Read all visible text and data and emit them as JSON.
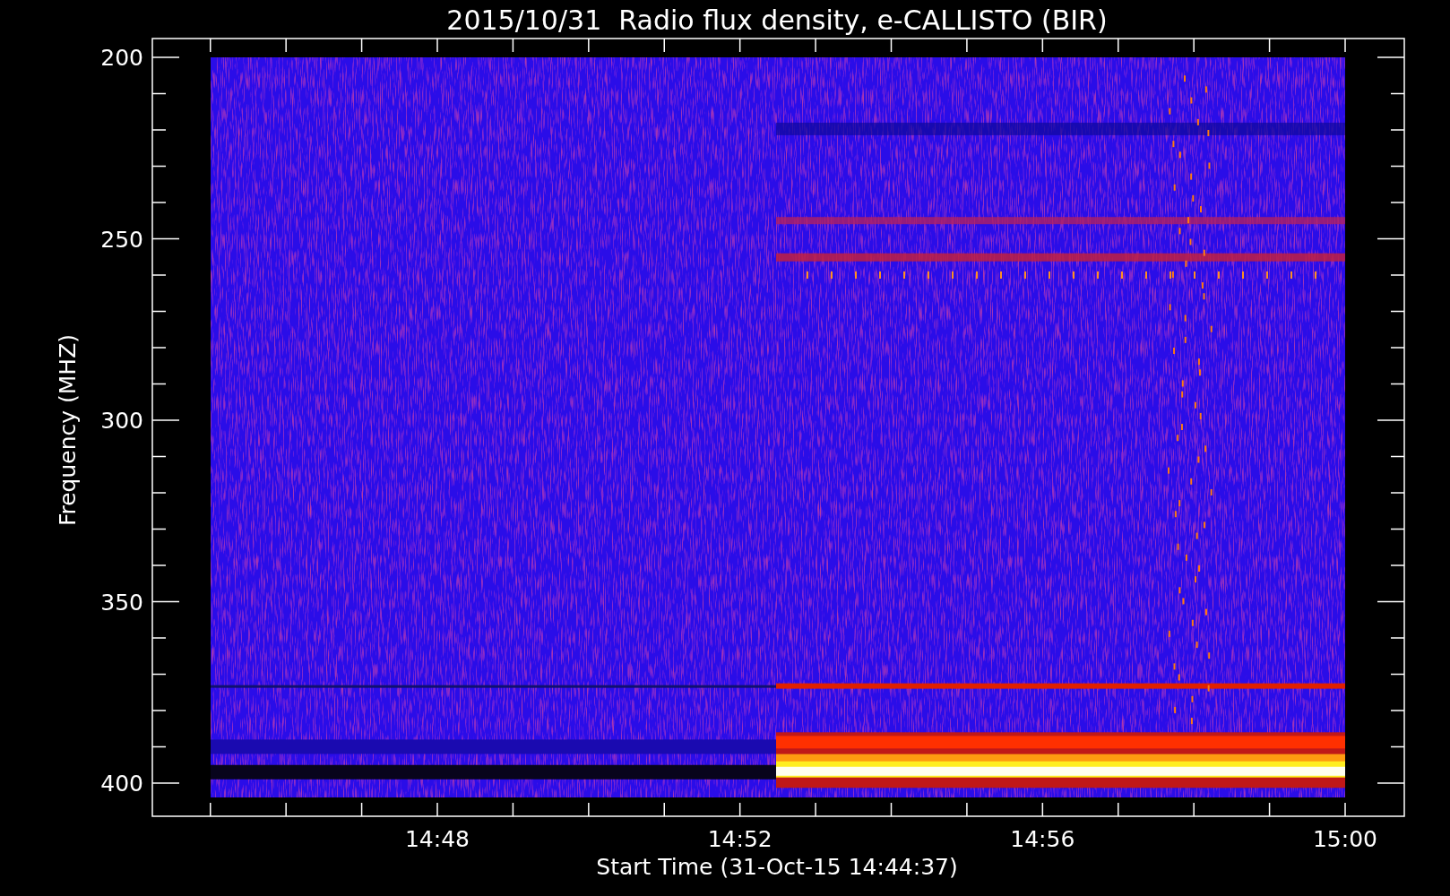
{
  "title": "2015/10/31  Radio flux density, e-CALLISTO (BIR)",
  "y_axis": {
    "label": "Frequency (MHZ)",
    "ticks": [
      "200",
      "250",
      "300",
      "350",
      "400"
    ]
  },
  "x_axis": {
    "label": "Start Time (31-Oct-15 14:44:37)",
    "ticks": [
      "14:48",
      "14:52",
      "14:56",
      "15:00"
    ]
  }
}
